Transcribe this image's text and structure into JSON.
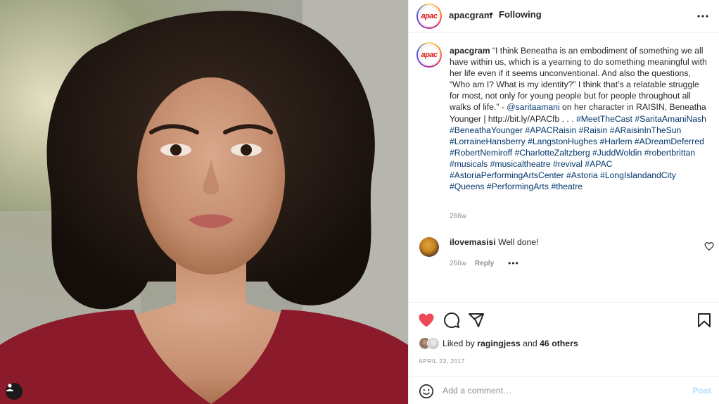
{
  "post": {
    "username": "apacgram",
    "separator": "•",
    "follow_status": "Following",
    "logo_text": "apac"
  },
  "caption": {
    "username": "apacgram",
    "text_part1": " “I think Beneatha is an embodiment of something we all have within us, which is a yearning to do something meaningful with her life even if it seems unconventional. And also the questions, “Who am I? What is my identity?” I think that’s a relatable struggle for most, not only for young people but for people throughout all walks of life.” - ",
    "mention": "@saritaamani",
    "text_part2": " on her character in RAISIN, Beneatha Younger | http://bit.ly/APACfb . . . ",
    "hashtags": [
      "#MeetTheCast",
      "#SaritaAmaniNash",
      "#BeneathaYounger",
      "#APACRaisin",
      "#Raisin",
      "#ARaisinInTheSun",
      "#LorraineHansberry",
      "#LangstonHughes",
      "#Harlem",
      "#ADreamDeferred",
      "#RobertNemiroff",
      "#CharlotteZaltzberg",
      "#JuddWoldin",
      "#robertbrittan",
      "#musicals",
      "#musicaltheatre",
      "#revival",
      "#APAC",
      "#AstoriaPerformingArtsCenter",
      "#Astoria",
      "#LongIslandandCity",
      "#Queens",
      "#PerformingArts",
      "#theatre"
    ],
    "time": "266w"
  },
  "comments": [
    {
      "username": "ilovemasisi",
      "text": " Well done!",
      "time": "266w",
      "reply_label": "Reply",
      "more": "•••"
    }
  ],
  "likes": {
    "prefix": "Liked by ",
    "user": "ragingjess",
    "joiner": " and ",
    "others": "46 others"
  },
  "date": "APRIL 23, 2017",
  "comment_box": {
    "placeholder": "Add a comment…",
    "post_label": "Post"
  },
  "colors": {
    "heart": "#ed4956",
    "link": "#00376b",
    "post_disabled": "#b2dffc",
    "brand_red": "#e01919"
  },
  "icons": [
    "more-icon",
    "heart-icon",
    "comment-icon",
    "share-icon",
    "bookmark-icon",
    "emoji-icon",
    "user-tag-icon",
    "small-heart-icon"
  ]
}
